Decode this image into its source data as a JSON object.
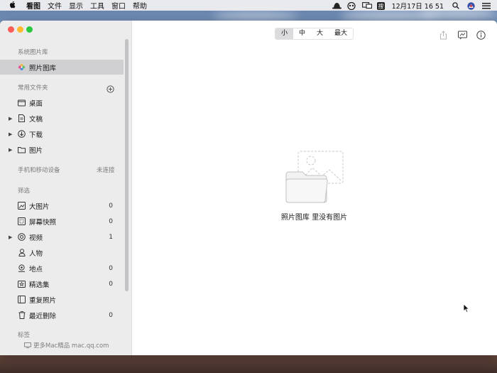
{
  "menubar": {
    "apple": "",
    "items": [
      "看图",
      "文件",
      "显示",
      "工具",
      "窗口",
      "帮助"
    ],
    "datetime": "12月17日 16 51"
  },
  "sidebar": {
    "section_library": "系统图片库",
    "library_item": "照片图库",
    "section_favorites": "常用文件夹",
    "favorites": [
      {
        "label": "桌面",
        "icon": "desktop-icon"
      },
      {
        "label": "文稿",
        "icon": "document-icon"
      },
      {
        "label": "下载",
        "icon": "download-icon"
      },
      {
        "label": "图片",
        "icon": "folder-icon"
      }
    ],
    "section_devices": "手机和移动设备",
    "devices_status": "未连接",
    "section_filter": "筛选",
    "filters": [
      {
        "label": "大图片",
        "count": "0",
        "icon": "large-image-icon"
      },
      {
        "label": "屏幕快照",
        "count": "0",
        "icon": "screenshot-icon"
      },
      {
        "label": "视频",
        "count": "1",
        "icon": "video-icon"
      },
      {
        "label": "人物",
        "count": "",
        "icon": "person-icon"
      },
      {
        "label": "地点",
        "count": "0",
        "icon": "location-icon"
      },
      {
        "label": "精选集",
        "count": "0",
        "icon": "collection-icon"
      },
      {
        "label": "重复照片",
        "count": "",
        "icon": "duplicate-icon"
      },
      {
        "label": "最近删除",
        "count": "0",
        "icon": "trash-icon"
      }
    ],
    "section_tags": "标签",
    "footer_link": "更多Mac精品 mac.qq.com"
  },
  "toolbar": {
    "sizes": [
      "小",
      "中",
      "大",
      "最大"
    ],
    "selected_size": "小"
  },
  "main": {
    "empty_message": "照片图库 里没有图片"
  }
}
